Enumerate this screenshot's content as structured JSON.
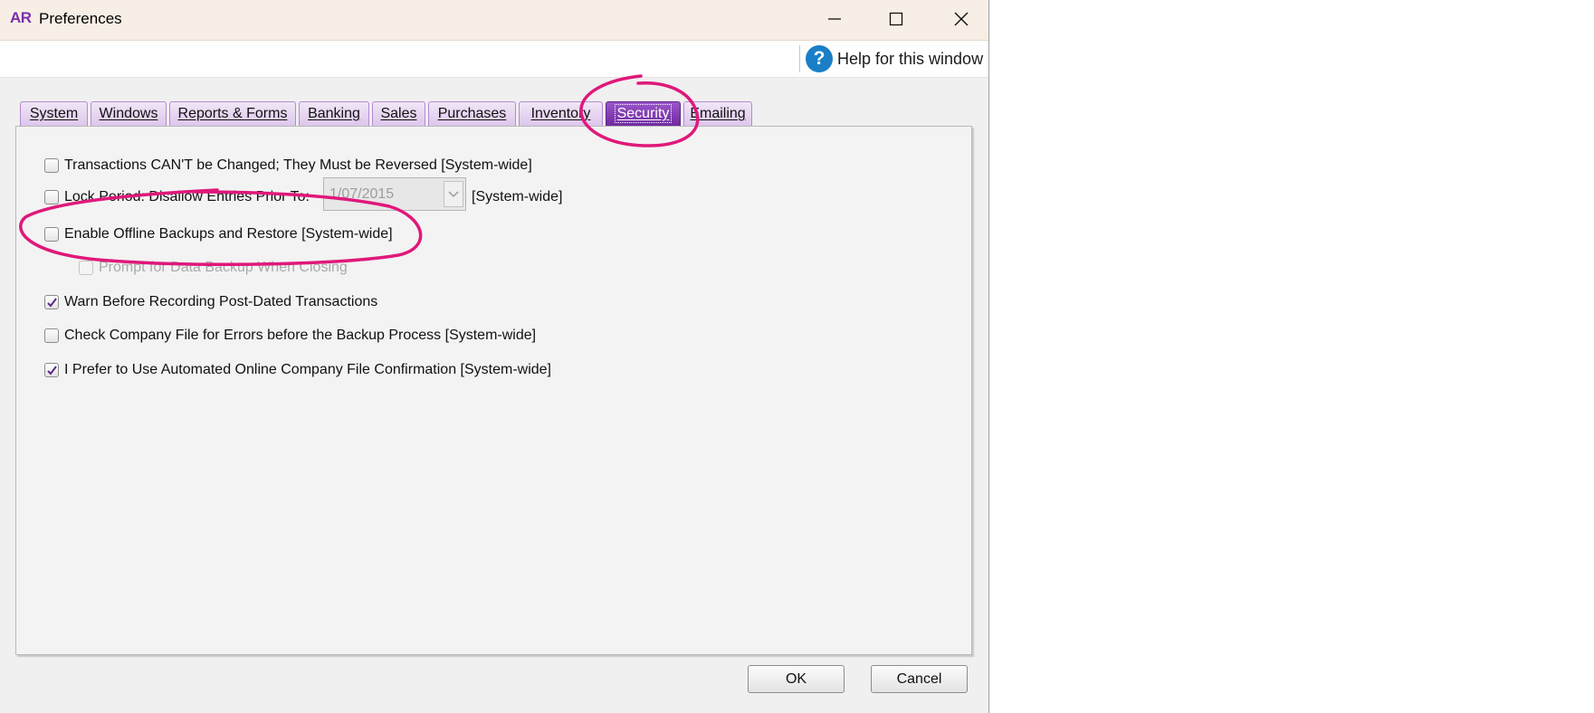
{
  "window": {
    "app_logo": "AR",
    "title": "Preferences",
    "help_label": "Help for this window"
  },
  "tabs": [
    {
      "label": "System",
      "active": false
    },
    {
      "label": "Windows",
      "active": false
    },
    {
      "label": "Reports & Forms",
      "active": false
    },
    {
      "label": "Banking",
      "active": false
    },
    {
      "label": "Sales",
      "active": false
    },
    {
      "label": "Purchases",
      "active": false
    },
    {
      "label": "Inventory",
      "active": false
    },
    {
      "label": "Security",
      "active": true
    },
    {
      "label": "Emailing",
      "active": false
    }
  ],
  "options": [
    {
      "label": "Transactions CAN'T be Changed; They Must be Reversed [System-wide]",
      "checked": false,
      "enabled": true
    },
    {
      "label": "Lock Period: Disallow Entries Prior To:",
      "checked": false,
      "enabled": true
    },
    {
      "label": "Enable Offline Backups and Restore [System-wide]",
      "checked": false,
      "enabled": true
    },
    {
      "label": "Prompt for Data Backup When Closing",
      "checked": false,
      "enabled": false
    },
    {
      "label": "Warn Before Recording Post-Dated Transactions",
      "checked": true,
      "enabled": true
    },
    {
      "label": "Check Company File for Errors before the Backup Process [System-wide]",
      "checked": false,
      "enabled": true
    },
    {
      "label": "I Prefer to Use Automated Online Company File Confirmation [System-wide]",
      "checked": true,
      "enabled": true
    }
  ],
  "lock_period": {
    "date_value": "1/07/2015",
    "suffix": "[System-wide]"
  },
  "buttons": {
    "ok": "OK",
    "cancel": "Cancel"
  },
  "colors": {
    "accent": "#7b2fa8",
    "annotation": "#e0187a",
    "help_icon": "#1a7fc7"
  },
  "icons": {
    "minimize": "minimize-icon",
    "maximize": "maximize-icon",
    "close": "close-icon",
    "help": "question-mark-icon",
    "dropdown": "chevron-down-icon",
    "check": "checkmark-icon"
  }
}
